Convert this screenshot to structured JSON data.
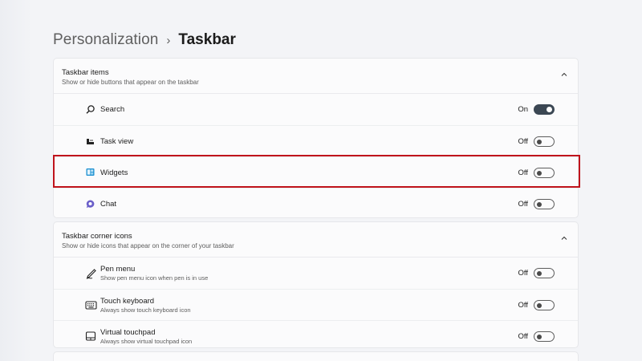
{
  "breadcrumb": {
    "parent": "Personalization",
    "separator": "›",
    "current": "Taskbar"
  },
  "sections": [
    {
      "title": "Taskbar items",
      "subtitle": "Show or hide buttons that appear on the taskbar",
      "collapse_icon": "chevron-up-icon",
      "items": [
        {
          "label": "Search",
          "icon": "search-icon",
          "state": "On",
          "toggle_on": true
        },
        {
          "label": "Task view",
          "icon": "task-view-icon",
          "state": "Off",
          "toggle_on": false
        },
        {
          "label": "Widgets",
          "icon": "widgets-icon",
          "state": "Off",
          "toggle_on": false,
          "highlighted": true
        },
        {
          "label": "Chat",
          "icon": "chat-icon",
          "state": "Off",
          "toggle_on": false
        }
      ]
    },
    {
      "title": "Taskbar corner icons",
      "subtitle": "Show or hide icons that appear on the corner of your taskbar",
      "collapse_icon": "chevron-up-icon",
      "items": [
        {
          "label": "Pen menu",
          "description": "Show pen menu icon when pen is in use",
          "icon": "pen-icon",
          "state": "Off",
          "toggle_on": false
        },
        {
          "label": "Touch keyboard",
          "description": "Always show touch keyboard icon",
          "icon": "keyboard-icon",
          "state": "Off",
          "toggle_on": false
        },
        {
          "label": "Virtual touchpad",
          "description": "Always show virtual touchpad icon",
          "icon": "touchpad-icon",
          "state": "Off",
          "toggle_on": false
        }
      ]
    }
  ],
  "colors": {
    "highlight_border": "#c0141c",
    "toggle_on": "#3b4753",
    "widgets_icon": "#1a8fd1",
    "chat_icon": "#6b5fc9"
  }
}
